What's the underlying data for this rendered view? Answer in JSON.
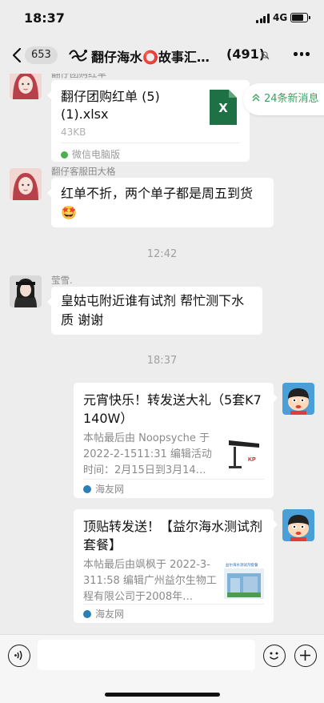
{
  "status_bar": {
    "time": "18:37",
    "network": "4G",
    "battery_level": 0.85
  },
  "nav": {
    "unread_count": "653",
    "title": "翻仔海水⭕故事汇…",
    "member_count": "(491)"
  },
  "new_messages_pill": "24条新消息",
  "messages": {
    "file": {
      "sender": "翻仔团购红单",
      "file_name": "翻仔团购红单 (5) (1).xlsx",
      "file_size": "43KB",
      "source": "微信电脑版",
      "file_icon_label": "X"
    },
    "text1": {
      "sender": "翻仔客服田大格",
      "text": "红单不折，两个单子都是周五到货",
      "emoji": "🤩"
    },
    "time1": "12:42",
    "text2": {
      "sender": "莹雪.",
      "text": "皇姑屯附近谁有试剂 帮忙测下水质 谢谢"
    },
    "time2": "18:37",
    "card1": {
      "title": "元宵快乐！转发送大礼（5套K7 140W）",
      "desc": "本帖最后由 Noopsyche 于 2022-2-1511:31 编辑活动时间：2月15日到3月14…",
      "source": "海友网",
      "thumb_label": "KP"
    },
    "card2": {
      "title": "顶贴转发送！【益尔海水测试剂套餐】",
      "desc": "本帖最后由飒枫于 2022-3-311:58 编辑广州益尔生物工程有限公司于2008年…",
      "source": "海友网",
      "thumb_label": "益尔海水测试剂套餐"
    }
  },
  "colors": {
    "background": "#ededed",
    "bubble": "#ffffff",
    "accent_green": "#36a55f",
    "excel_green": "#1e7145"
  }
}
